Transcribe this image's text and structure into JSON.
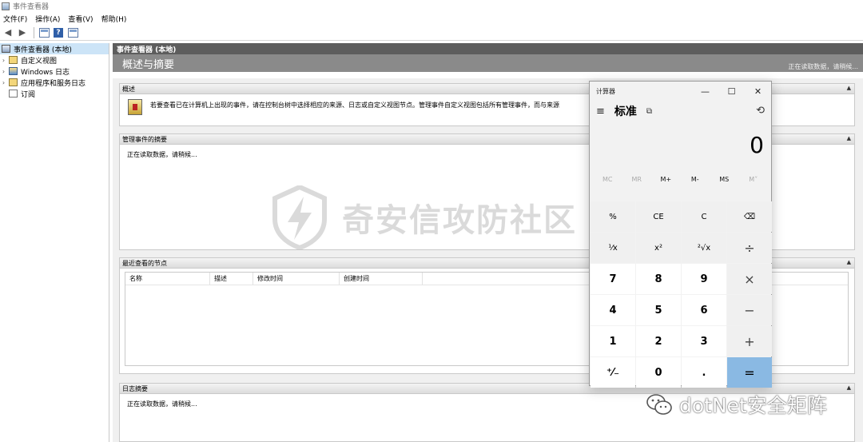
{
  "window": {
    "title": "事件查看器"
  },
  "menu": [
    "文件(F)",
    "操作(A)",
    "查看(V)",
    "帮助(H)"
  ],
  "toolbar": {
    "back_icon": "◀",
    "forward_icon": "▶",
    "help_label": "?"
  },
  "tree": {
    "items": [
      {
        "label": "事件查看器 (本地)"
      },
      {
        "label": "自定义视图"
      },
      {
        "label": "Windows 日志"
      },
      {
        "label": "应用程序和服务日志"
      },
      {
        "label": "订阅"
      }
    ]
  },
  "main": {
    "header": "事件查看器 (本地)",
    "subheader": "概述与摘要",
    "status": "正在读取数据，请稍候...",
    "sections": {
      "overview": {
        "title": "概述",
        "text": "若要查看已在计算机上出现的事件，请在控制台树中选择相应的来源、日志或自定义视图节点。管理事件自定义视图包括所有管理事件，而与来源"
      },
      "admin_summary": {
        "title": "管理事件的摘要",
        "text": "正在读取数据，请稍候..."
      },
      "recent_nodes": {
        "title": "最近查看的节点",
        "columns": [
          "名称",
          "描述",
          "修改时间",
          "创建时间"
        ]
      },
      "log_summary": {
        "title": "日志摘要",
        "text": "正在读取数据，请稍候..."
      }
    }
  },
  "watermark": {
    "text": "奇安信攻防社区"
  },
  "wechat": {
    "text": "dotNet安全矩阵"
  },
  "calculator": {
    "title": "计算器",
    "mode": "标准",
    "display": "0",
    "window_controls": {
      "minimize": "—",
      "maximize": "☐",
      "close": "✕"
    },
    "nav": {
      "menu": "≡",
      "keep_on_top": "⧉",
      "history": "⟲"
    },
    "memory": [
      {
        "label": "MC",
        "enabled": false
      },
      {
        "label": "MR",
        "enabled": false
      },
      {
        "label": "M+",
        "enabled": true
      },
      {
        "label": "M-",
        "enabled": true
      },
      {
        "label": "MS",
        "enabled": true
      },
      {
        "label": "M˅",
        "enabled": false
      }
    ],
    "keys": {
      "percent": "%",
      "ce": "CE",
      "c": "C",
      "backspace": "⌫",
      "reciprocal": "¹⁄x",
      "square": "x²",
      "sqrt": "²√x",
      "divide": "÷",
      "seven": "7",
      "eight": "8",
      "nine": "9",
      "multiply": "×",
      "four": "4",
      "five": "5",
      "six": "6",
      "minus": "−",
      "one": "1",
      "two": "2",
      "three": "3",
      "plus": "+",
      "negate": "⁺⁄₋",
      "zero": "0",
      "decimal": ".",
      "equals": "="
    }
  }
}
